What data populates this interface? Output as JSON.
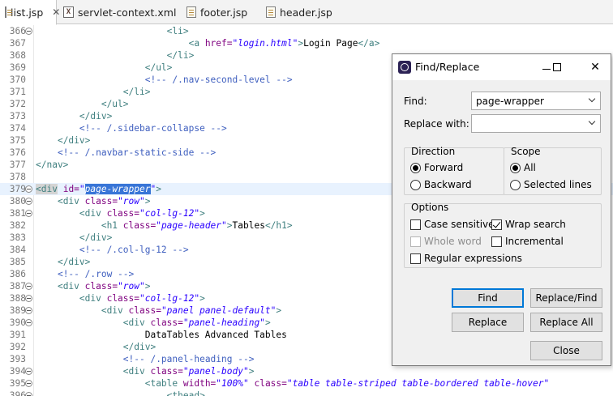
{
  "tabs": [
    {
      "label": "list.jsp",
      "active": true,
      "closable": true,
      "icon": "jsp-file-icon"
    },
    {
      "label": "servlet-context.xml",
      "active": false,
      "icon": "xml-file-icon"
    },
    {
      "label": "footer.jsp",
      "active": false,
      "icon": "jsp-file-icon"
    },
    {
      "label": "header.jsp",
      "active": false,
      "icon": "jsp-file-icon"
    }
  ],
  "editor": {
    "current_line": "379",
    "lines": [
      {
        "n": "366",
        "fold": true
      },
      {
        "n": "367",
        "fold": false
      },
      {
        "n": "368",
        "fold": false
      },
      {
        "n": "369",
        "fold": false
      },
      {
        "n": "370",
        "fold": false
      },
      {
        "n": "371",
        "fold": false
      },
      {
        "n": "372",
        "fold": false
      },
      {
        "n": "373",
        "fold": false
      },
      {
        "n": "374",
        "fold": false
      },
      {
        "n": "375",
        "fold": false
      },
      {
        "n": "376",
        "fold": false
      },
      {
        "n": "377",
        "fold": false
      },
      {
        "n": "378",
        "fold": false
      },
      {
        "n": "379",
        "fold": true
      },
      {
        "n": "380",
        "fold": true
      },
      {
        "n": "381",
        "fold": true
      },
      {
        "n": "382",
        "fold": false
      },
      {
        "n": "383",
        "fold": false
      },
      {
        "n": "384",
        "fold": false
      },
      {
        "n": "385",
        "fold": false
      },
      {
        "n": "386",
        "fold": false
      },
      {
        "n": "387",
        "fold": true
      },
      {
        "n": "388",
        "fold": true
      },
      {
        "n": "389",
        "fold": true
      },
      {
        "n": "390",
        "fold": true
      },
      {
        "n": "391",
        "fold": false
      },
      {
        "n": "392",
        "fold": false
      },
      {
        "n": "393",
        "fold": false
      },
      {
        "n": "394",
        "fold": true
      },
      {
        "n": "395",
        "fold": true
      },
      {
        "n": "396",
        "fold": true
      }
    ],
    "code": [
      [
        [
          "                        ",
          "tx"
        ],
        [
          "<li>",
          "tg"
        ]
      ],
      [
        [
          "                            ",
          "tx"
        ],
        [
          "<a ",
          "tg"
        ],
        [
          "href=",
          "at"
        ],
        [
          "\"login.html\"",
          "av"
        ],
        [
          ">",
          "tg"
        ],
        [
          "Login Page",
          "tx"
        ],
        [
          "</a>",
          "tg"
        ]
      ],
      [
        [
          "                        ",
          "tx"
        ],
        [
          "</li>",
          "tg"
        ]
      ],
      [
        [
          "                    ",
          "tx"
        ],
        [
          "</ul>",
          "tg"
        ]
      ],
      [
        [
          "                    ",
          "tx"
        ],
        [
          "<!-- /.nav-second-level -->",
          "cm"
        ]
      ],
      [
        [
          "                ",
          "tx"
        ],
        [
          "</li>",
          "tg"
        ]
      ],
      [
        [
          "            ",
          "tx"
        ],
        [
          "</ul>",
          "tg"
        ]
      ],
      [
        [
          "        ",
          "tx"
        ],
        [
          "</div>",
          "tg"
        ]
      ],
      [
        [
          "        ",
          "tx"
        ],
        [
          "<!-- /.sidebar-collapse -->",
          "cm"
        ]
      ],
      [
        [
          "    ",
          "tx"
        ],
        [
          "</div>",
          "tg"
        ]
      ],
      [
        [
          "    ",
          "tx"
        ],
        [
          "<!-- /.navbar-static-side -->",
          "cm"
        ]
      ],
      [
        [
          "",
          "tx"
        ],
        [
          "</nav>",
          "tg"
        ]
      ],
      [
        [
          "",
          "tx"
        ]
      ],
      [
        [
          "",
          "tx"
        ],
        [
          "<div",
          "tg mark"
        ],
        [
          " ",
          "tx"
        ],
        [
          "id=",
          "at"
        ],
        [
          "\"",
          "av"
        ],
        [
          "page-wrapper",
          "av sel"
        ],
        [
          "\"",
          "av"
        ],
        [
          ">",
          "tg"
        ]
      ],
      [
        [
          "    ",
          "tx"
        ],
        [
          "<div ",
          "tg"
        ],
        [
          "class=",
          "at"
        ],
        [
          "\"row\"",
          "av"
        ],
        [
          ">",
          "tg"
        ]
      ],
      [
        [
          "        ",
          "tx"
        ],
        [
          "<div ",
          "tg"
        ],
        [
          "class=",
          "at"
        ],
        [
          "\"col-lg-12\"",
          "av"
        ],
        [
          ">",
          "tg"
        ]
      ],
      [
        [
          "            ",
          "tx"
        ],
        [
          "<h1 ",
          "tg"
        ],
        [
          "class=",
          "at"
        ],
        [
          "\"page-header\"",
          "av"
        ],
        [
          ">",
          "tg"
        ],
        [
          "Tables",
          "tx"
        ],
        [
          "</h1>",
          "tg"
        ]
      ],
      [
        [
          "        ",
          "tx"
        ],
        [
          "</div>",
          "tg"
        ]
      ],
      [
        [
          "        ",
          "tx"
        ],
        [
          "<!-- /.col-lg-12 -->",
          "cm"
        ]
      ],
      [
        [
          "    ",
          "tx"
        ],
        [
          "</div>",
          "tg"
        ]
      ],
      [
        [
          "    ",
          "tx"
        ],
        [
          "<!-- /.row -->",
          "cm"
        ]
      ],
      [
        [
          "    ",
          "tx"
        ],
        [
          "<div ",
          "tg"
        ],
        [
          "class=",
          "at"
        ],
        [
          "\"row\"",
          "av"
        ],
        [
          ">",
          "tg"
        ]
      ],
      [
        [
          "        ",
          "tx"
        ],
        [
          "<div ",
          "tg"
        ],
        [
          "class=",
          "at"
        ],
        [
          "\"col-lg-12\"",
          "av"
        ],
        [
          ">",
          "tg"
        ]
      ],
      [
        [
          "            ",
          "tx"
        ],
        [
          "<div ",
          "tg"
        ],
        [
          "class=",
          "at"
        ],
        [
          "\"panel panel-default\"",
          "av"
        ],
        [
          ">",
          "tg"
        ]
      ],
      [
        [
          "                ",
          "tx"
        ],
        [
          "<div ",
          "tg"
        ],
        [
          "class=",
          "at"
        ],
        [
          "\"panel-heading\"",
          "av"
        ],
        [
          ">",
          "tg"
        ]
      ],
      [
        [
          "                    ",
          "tx"
        ],
        [
          "DataTables Advanced Tables",
          "tx"
        ]
      ],
      [
        [
          "                ",
          "tx"
        ],
        [
          "</div>",
          "tg"
        ]
      ],
      [
        [
          "                ",
          "tx"
        ],
        [
          "<!-- /.panel-heading -->",
          "cm"
        ]
      ],
      [
        [
          "                ",
          "tx"
        ],
        [
          "<div ",
          "tg"
        ],
        [
          "class=",
          "at"
        ],
        [
          "\"panel-body\"",
          "av"
        ],
        [
          ">",
          "tg"
        ]
      ],
      [
        [
          "                    ",
          "tx"
        ],
        [
          "<table ",
          "tg"
        ],
        [
          "width=",
          "at"
        ],
        [
          "\"100%\"",
          "av"
        ],
        [
          " ",
          "tx"
        ],
        [
          "class=",
          "at"
        ],
        [
          "\"table table-striped table-bordered table-hover\"",
          "av"
        ]
      ],
      [
        [
          "                        ",
          "tx"
        ],
        [
          "<thead>",
          "tg"
        ]
      ]
    ]
  },
  "dialog": {
    "title": "Find/Replace",
    "find_label": "Find:",
    "find_value": "page-wrapper",
    "replace_label": "Replace with:",
    "replace_value": "",
    "direction": {
      "title": "Direction",
      "forward": "Forward",
      "backward": "Backward",
      "selected": "Forward"
    },
    "scope": {
      "title": "Scope",
      "all": "All",
      "selected_lines": "Selected lines",
      "selected": "All"
    },
    "options": {
      "title": "Options",
      "case_sensitive": {
        "label": "Case sensitive",
        "checked": false
      },
      "wrap_search": {
        "label": "Wrap search",
        "checked": true
      },
      "whole_word": {
        "label": "Whole word",
        "checked": false,
        "disabled": true
      },
      "incremental": {
        "label": "Incremental",
        "checked": false
      },
      "regular_expressions": {
        "label": "Regular expressions",
        "checked": false
      }
    },
    "buttons": {
      "find": "Find",
      "replace_find": "Replace/Find",
      "replace": "Replace",
      "replace_all": "Replace All",
      "close": "Close"
    }
  }
}
